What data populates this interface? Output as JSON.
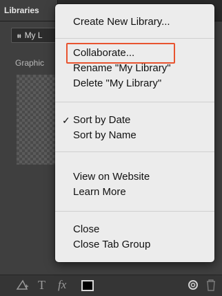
{
  "panel": {
    "tab_label": "Libraries",
    "library_selector": "My L",
    "section_title": "Graphic"
  },
  "menu": {
    "create_new_library": "Create New Library...",
    "collaborate": "Collaborate...",
    "rename_library": "Rename \"My Library\"",
    "delete_library": "Delete \"My Library\"",
    "sort_by_date": "Sort by Date",
    "sort_by_name": "Sort by Name",
    "view_on_website": "View on Website",
    "learn_more": "Learn More",
    "close": "Close",
    "close_tab_group": "Close Tab Group",
    "checked_item": "Sort by Date",
    "checkmark": "✓"
  },
  "bottom_toolbar": {
    "icons": [
      "add-graphic-icon",
      "add-text-icon",
      "add-effect-icon",
      "color-swatch",
      "creative-cloud-sync-icon",
      "trash-icon"
    ],
    "swatch_color": "#000000"
  },
  "highlight_color": "#e8532f"
}
